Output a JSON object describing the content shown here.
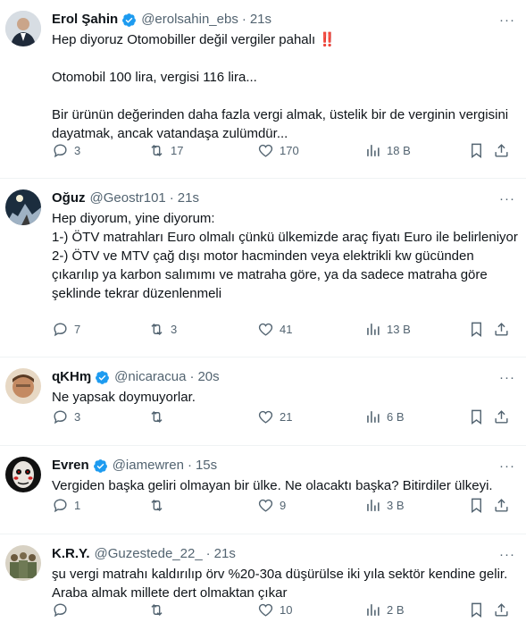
{
  "tweets": [
    {
      "name": "Erol Şahin",
      "verified": true,
      "handle": "@erolsahin_ebs",
      "time": "21s",
      "text": "Hep diyoruz Otomobiller değil vergiler pahalı ‼️\n\nOtomobil 100 lira, vergisi 116 lira...\n\nBir ürünün değerinden daha fazla vergi almak, üstelik bir de verginin vergisini dayatmak, ancak vatandaşa zulümdür...",
      "replies": "3",
      "reposts": "17",
      "likes": "170",
      "views": "18 B"
    },
    {
      "name": "Oğuz",
      "verified": false,
      "handle": "@Geostr101",
      "time": "21s",
      "text": "Hep diyorum, yine diyorum:\n1-) ÖTV matrahları Euro olmalı çünkü ülkemizde araç fiyatı Euro ile belirleniyor\n2-) ÖTV ve MTV çağ dışı motor hacminden veya elektrikli kw gücünden çıkarılıp ya karbon salımımı ve matraha göre, ya da sadece matraha göre şeklinde tekrar düzenlenmeli",
      "replies": "7",
      "reposts": "3",
      "likes": "41",
      "views": "13 B"
    },
    {
      "name": "ɋKHɱ",
      "verified": true,
      "handle": "@nicaracua",
      "time": "20s",
      "text": "Ne yapsak doymuyorlar.",
      "replies": "3",
      "reposts": "",
      "likes": "21",
      "views": "6 B"
    },
    {
      "name": "Evren",
      "verified": true,
      "handle": "@iamewren",
      "time": "15s",
      "text": "Vergiden başka geliri olmayan bir ülke. Ne olacaktı başka? Bitirdiler ülkeyi.",
      "replies": "1",
      "reposts": "",
      "likes": "9",
      "views": "3 B"
    },
    {
      "name": "K.R.Y.",
      "verified": false,
      "handle": "@Guzestede_22_",
      "time": "21s",
      "text": "şu vergi matrahı kaldırılıp örv %20-30a düşürülse iki yıla sektör kendine gelir. Araba almak millete dert olmaktan çıkar",
      "replies": "",
      "reposts": "",
      "likes": "10",
      "views": "2 B"
    }
  ],
  "more_glyph": "···",
  "dot": "·",
  "colors": {
    "text": "#0f1419",
    "secondary": "#536471",
    "verified": "#1d9bf0",
    "divider": "#eff3f4"
  }
}
